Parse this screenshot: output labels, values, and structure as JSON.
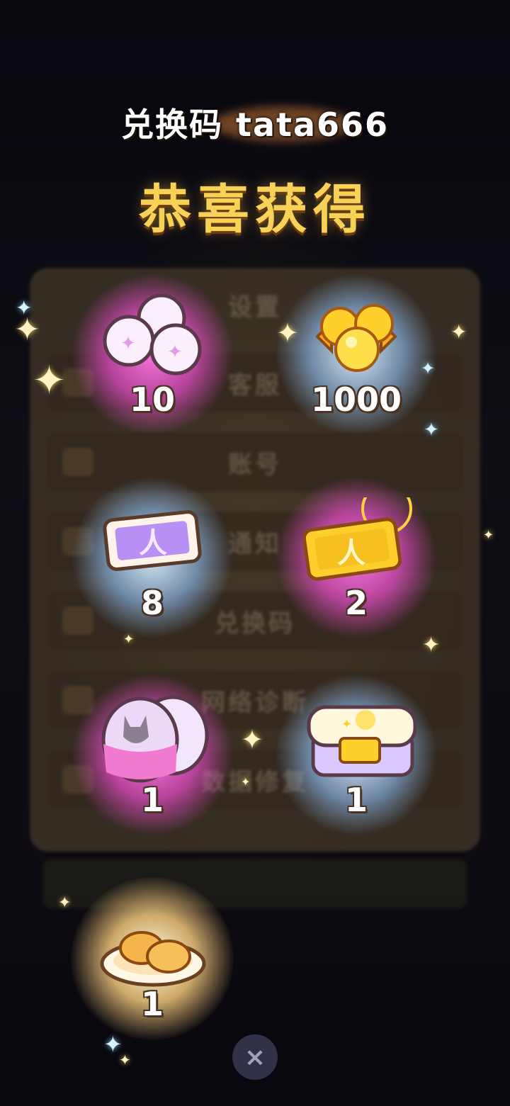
{
  "header": {
    "title": "兑换码 tata666",
    "congrats": "恭喜获得"
  },
  "background_panel": {
    "rows": [
      "设置",
      "客服",
      "账号",
      "通知",
      "兑换码",
      "网络诊断",
      "数据修复"
    ]
  },
  "rewards": [
    {
      "name": "white-orbs",
      "count": "10"
    },
    {
      "name": "gold-coins",
      "count": "1000"
    },
    {
      "name": "purple-ticket",
      "count": "8"
    },
    {
      "name": "gold-ticket",
      "count": "2"
    },
    {
      "name": "capsule",
      "count": "1"
    },
    {
      "name": "treasure-box",
      "count": "1"
    },
    {
      "name": "bread-plate",
      "count": "1"
    }
  ],
  "close": {
    "icon": "close-icon",
    "glyph": "×"
  },
  "colors": {
    "congrats": "#f7d256",
    "pink_glow": "#f050d2",
    "blue_glow": "#96c8ff",
    "gold_glow": "#ffd282"
  }
}
